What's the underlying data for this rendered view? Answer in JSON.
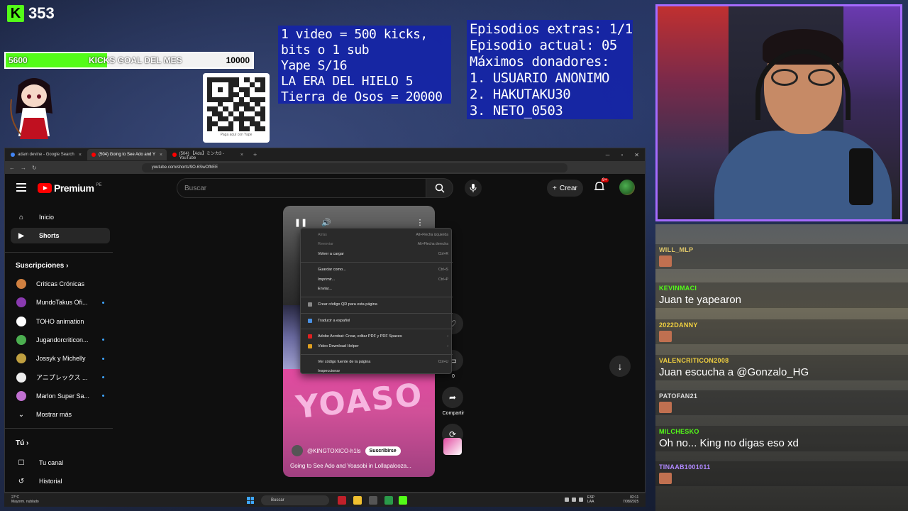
{
  "overlay": {
    "kick_count": "353",
    "goal": {
      "start": "5600",
      "label": "KICKS GOAL DEL MES",
      "end": "10000",
      "progress_fraction": 0.41,
      "fill_color": "#53fc18"
    },
    "qr_caption": "Paga aquí con Yape",
    "info1": [
      "1 video = 500 kicks,",
      "bits o 1 sub",
      "Yape S/16",
      "LA ERA DEL HIELO 5",
      "Tierra de Osos = 20000"
    ],
    "info2": [
      "Episodios extras: 1/1",
      "Episodio actual: 05",
      "Máximos donadores:",
      "1. USUARIO ANONIMO",
      "2. HAKUTAKU30",
      "3. NETO_0503"
    ]
  },
  "chat": [
    {
      "user": "WILL_MLP",
      "color": "#e0c86a",
      "text": "",
      "emote": true
    },
    {
      "user": "KEVINMACI",
      "color": "#53fc18",
      "text": "Juan te yapearon",
      "emote": false
    },
    {
      "user": "2022DANNY",
      "color": "#f0d040",
      "text": "",
      "emote": true
    },
    {
      "user": "VALENCRITICON2008",
      "color": "#f0d040",
      "text": "Juan escucha a @Gonzalo_HG",
      "emote": false
    },
    {
      "user": "PATOFAN21",
      "color": "#dddddd",
      "text": "",
      "emote": true
    },
    {
      "user": "MILCHESKO",
      "color": "#53fc18",
      "text": "Oh no... King no digas eso xd",
      "emote": false
    },
    {
      "user": "TINAAB1001011",
      "color": "#b088ff",
      "text": "",
      "emote": true
    }
  ],
  "browser": {
    "tabs": [
      {
        "label": "adam devine - Google Search",
        "active": false,
        "favicon_color": "#4285f4"
      },
      {
        "label": "(504) Going to See Ado and Y",
        "active": true,
        "favicon_color": "#ff0000"
      },
      {
        "label": "(504) 【Ado】ミンカ3 - YouTube",
        "active": false,
        "favicon_color": "#ff0000"
      }
    ],
    "url": "youtube.com/shorts/9O-6SwOfhEE"
  },
  "youtube": {
    "logo_text": "Premium",
    "region": "PE",
    "search_placeholder": "Buscar",
    "create_label": "Crear",
    "notif_badge": "9+",
    "sidebar": {
      "main": [
        {
          "label": "Inicio",
          "icon": "home-icon",
          "active": false
        },
        {
          "label": "Shorts",
          "icon": "shorts-icon",
          "active": true
        }
      ],
      "subs_heading": "Suscripciones",
      "subs": [
        {
          "label": "Criticas Crónicas",
          "color": "#d08040",
          "dot": false
        },
        {
          "label": "MundoTakus Ofi...",
          "color": "#8a3ab0",
          "dot": true
        },
        {
          "label": "TOHO animation",
          "color": "#ffffff",
          "dot": false
        },
        {
          "label": "Jugandorcriticon...",
          "color": "#4caf50",
          "dot": true
        },
        {
          "label": "Jossyk y Michelly",
          "color": "#c0a040",
          "dot": true
        },
        {
          "label": "アニプレックス ...",
          "color": "#eeeeee",
          "dot": true
        },
        {
          "label": "Marlon Super Sa...",
          "color": "#c070d0",
          "dot": true
        }
      ],
      "show_more": "Mostrar más",
      "you_heading": "Tú",
      "you_items": [
        {
          "label": "Tu canal",
          "icon": "channel-icon"
        },
        {
          "label": "Historial",
          "icon": "history-icon"
        }
      ]
    },
    "short": {
      "channel": "@KINGTOXICO-h1ls",
      "subscribe": "Suscribirse",
      "title": "Going to See Ado and Yoasobi in Lollapalooza...",
      "overlay_text": "YOASO",
      "actions": [
        {
          "label": "",
          "icon": "like-icon"
        },
        {
          "label": "0",
          "icon": "comment-icon"
        },
        {
          "label": "Compartir",
          "icon": "share-icon"
        },
        {
          "label": "Remix",
          "icon": "remix-icon"
        }
      ]
    },
    "context_menu": [
      {
        "label": "Atrás",
        "shortcut": "Alt+Flecha izquierda",
        "disabled": true
      },
      {
        "label": "Reenviar",
        "shortcut": "Alt+Flecha derecha",
        "disabled": true
      },
      {
        "label": "Volver a cargar",
        "shortcut": "Ctrl+R",
        "disabled": false
      },
      {
        "sep": true
      },
      {
        "label": "Guardar como...",
        "shortcut": "Ctrl+S",
        "disabled": false
      },
      {
        "label": "Imprimir...",
        "shortcut": "Ctrl+P",
        "disabled": false
      },
      {
        "label": "Enviar...",
        "shortcut": "",
        "disabled": false
      },
      {
        "sep": true
      },
      {
        "label": "Crear código QR para esta página",
        "shortcut": "",
        "disabled": false,
        "icon": "#888888"
      },
      {
        "sep": true
      },
      {
        "label": "Traducir a español",
        "shortcut": "",
        "disabled": false,
        "icon": "#4a90e2"
      },
      {
        "sep": true
      },
      {
        "label": "Adobe Acrobat: Crear, editar PDF y PDF Spaces",
        "shortcut": "›",
        "disabled": false,
        "icon": "#e02020"
      },
      {
        "label": "Video Download Helper",
        "shortcut": "›",
        "disabled": false,
        "icon": "#e0a020"
      },
      {
        "sep": true
      },
      {
        "label": "Ver código fuente de la página",
        "shortcut": "Ctrl+U",
        "disabled": false
      },
      {
        "label": "Inspeccionar",
        "shortcut": "",
        "disabled": false
      }
    ]
  },
  "taskbar": {
    "weather_temp": "27°C",
    "weather_desc": "Mayorm. nublado",
    "search": "Buscar",
    "lang1": "ESP",
    "lang2": "LAA",
    "time": "02:11",
    "date": "7/08/2025"
  }
}
